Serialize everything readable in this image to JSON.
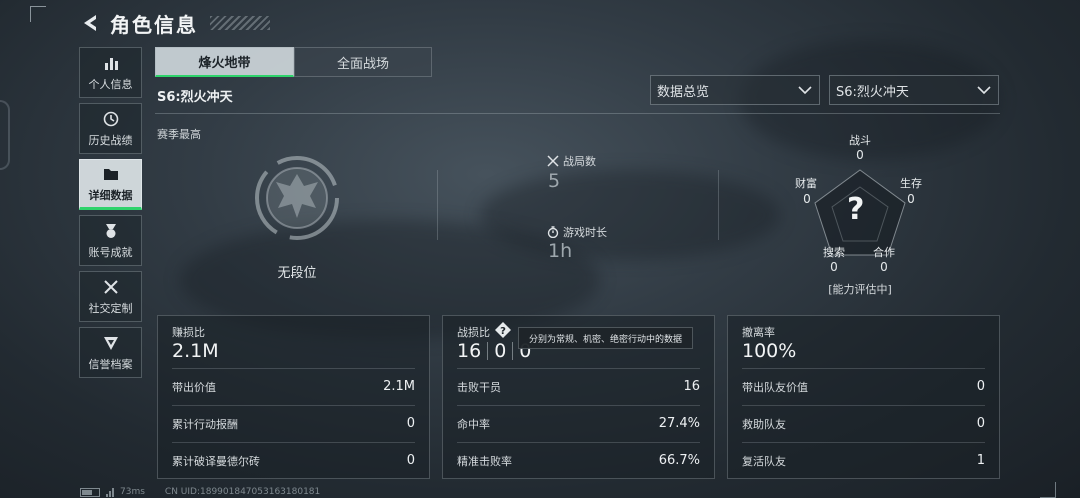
{
  "header": {
    "title": "角色信息"
  },
  "nav": [
    {
      "label": "个人信息",
      "icon": "bar-chart-icon",
      "active": false
    },
    {
      "label": "历史战绩",
      "icon": "history-icon",
      "active": false
    },
    {
      "label": "详细数据",
      "icon": "folder-icon",
      "active": true
    },
    {
      "label": "账号成就",
      "icon": "medal-icon",
      "active": false
    },
    {
      "label": "社交定制",
      "icon": "tools-icon",
      "active": false
    },
    {
      "label": "信誉档案",
      "icon": "credibility-icon",
      "active": false
    }
  ],
  "tabs": [
    {
      "label": "烽火地带",
      "active": true
    },
    {
      "label": "全面战场",
      "active": false
    }
  ],
  "season_name": "S6:烈火冲天",
  "filters": {
    "view": "数据总览",
    "season": "S6:烈火冲天"
  },
  "section_label": "赛季最高",
  "rank": {
    "text": "无段位"
  },
  "stats": {
    "matches": {
      "label": "战局数",
      "value": "5"
    },
    "playtime": {
      "label": "游戏时长",
      "value": "1h"
    }
  },
  "radar": {
    "center": "?",
    "status": "[能力评估中]",
    "axes": [
      {
        "label": "战斗",
        "value": "0"
      },
      {
        "label": "生存",
        "value": "0"
      },
      {
        "label": "合作",
        "value": "0"
      },
      {
        "label": "搜索",
        "value": "0"
      },
      {
        "label": "财富",
        "value": "0"
      }
    ]
  },
  "panels": {
    "profit": {
      "title": "赚损比",
      "value": "2.1M",
      "rows": [
        {
          "label": "带出价值",
          "value": "2.1M"
        },
        {
          "label": "累计行动报酬",
          "value": "0"
        },
        {
          "label": "累计破译曼德尔砖",
          "value": "0"
        }
      ]
    },
    "kd": {
      "title": "战损比",
      "values": [
        "16",
        "0",
        "0"
      ],
      "tooltip": "分别为常规、机密、绝密行动中的数据",
      "rows": [
        {
          "label": "击败干员",
          "value": "16"
        },
        {
          "label": "命中率",
          "value": "27.4%"
        },
        {
          "label": "精准击败率",
          "value": "66.7%"
        }
      ]
    },
    "extract": {
      "title": "撤离率",
      "value": "100%",
      "rows": [
        {
          "label": "带出队友价值",
          "value": "0"
        },
        {
          "label": "救助队友",
          "value": "0"
        },
        {
          "label": "复活队友",
          "value": "1"
        }
      ]
    }
  },
  "footer": {
    "ping": "73ms",
    "uid": "CN UID:18990184705316318018​1"
  }
}
